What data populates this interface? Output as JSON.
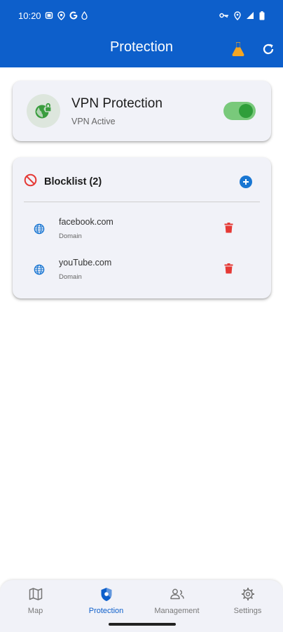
{
  "status_bar": {
    "time": "10:20",
    "left_icons": [
      "screen-cast-icon",
      "location-shield-icon",
      "google-icon",
      "water-drop-icon"
    ],
    "right_icons": [
      "vpn-key-icon",
      "location-icon",
      "signal-icon",
      "battery-icon"
    ]
  },
  "header": {
    "title": "Protection",
    "actions": [
      "beaker-icon",
      "refresh-icon"
    ],
    "background": "#0d5fcb",
    "beaker_color": "#f5a623"
  },
  "vpn_card": {
    "title": "VPN Protection",
    "status": "VPN Active",
    "icon": "vpn-globe-lock-icon",
    "toggle_on": true,
    "accent": "#2f9e3a"
  },
  "blocklist": {
    "title": "Blocklist (2)",
    "icon": "block-icon",
    "add_icon": "add-circle-icon",
    "items": [
      {
        "name": "facebook.com",
        "type": "Domain",
        "icon": "globe-icon",
        "delete_icon": "trash-icon"
      },
      {
        "name": "youTube.com",
        "type": "Domain",
        "icon": "globe-icon",
        "delete_icon": "trash-icon"
      }
    ],
    "delete_color": "#e53935",
    "globe_color": "#1976d2"
  },
  "bottom_nav": {
    "items": [
      {
        "label": "Map",
        "icon": "map-icon",
        "active": false
      },
      {
        "label": "Protection",
        "icon": "shield-icon",
        "active": true
      },
      {
        "label": "Management",
        "icon": "people-icon",
        "active": false
      },
      {
        "label": "Settings",
        "icon": "gear-icon",
        "active": false
      }
    ]
  }
}
